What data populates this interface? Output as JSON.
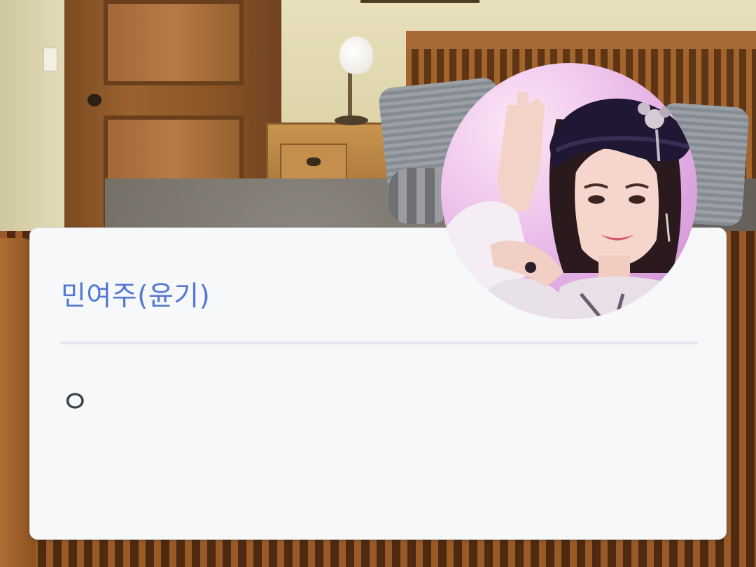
{
  "dialog": {
    "speaker_name": "민여주(윤기)",
    "message": "ㅇ"
  },
  "avatar": {
    "icon": "character-portrait"
  },
  "background": {
    "scene": "bedroom"
  },
  "colors": {
    "speaker_name": "#5578d2",
    "card_background": "#f6f8fa",
    "message_text": "#3e4247",
    "divider": "#e4e8ee"
  }
}
